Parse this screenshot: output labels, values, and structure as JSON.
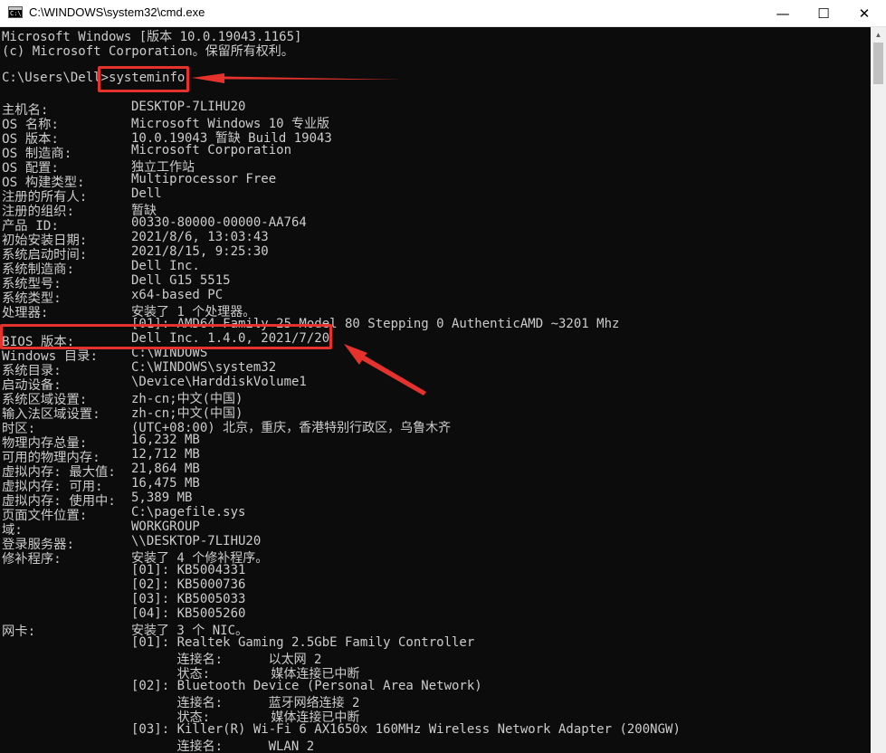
{
  "window": {
    "title": "C:\\WINDOWS\\system32\\cmd.exe",
    "minimize_glyph": "—",
    "maximize_glyph": "☐",
    "close_glyph": "✕"
  },
  "console": {
    "header_lines": [
      "Microsoft Windows [版本 10.0.19043.1165]",
      "(c) Microsoft Corporation。保留所有权利。"
    ],
    "prompt": "C:\\Users\\Dell>",
    "command": "systeminfo",
    "rows": [
      {
        "key": "主机名:",
        "value": "DESKTOP-7LIHU20"
      },
      {
        "key": "OS 名称:",
        "value": "Microsoft Windows 10 专业版"
      },
      {
        "key": "OS 版本:",
        "value": "10.0.19043 暂缺 Build 19043"
      },
      {
        "key": "OS 制造商:",
        "value": "Microsoft Corporation"
      },
      {
        "key": "OS 配置:",
        "value": "独立工作站"
      },
      {
        "key": "OS 构建类型:",
        "value": "Multiprocessor Free"
      },
      {
        "key": "注册的所有人:",
        "value": "Dell"
      },
      {
        "key": "注册的组织:",
        "value": "暂缺"
      },
      {
        "key": "产品 ID:",
        "value": "00330-80000-00000-AA764"
      },
      {
        "key": "初始安装日期:",
        "value": "2021/8/6, 13:03:43"
      },
      {
        "key": "系统启动时间:",
        "value": "2021/8/15, 9:25:30"
      },
      {
        "key": "系统制造商:",
        "value": "Dell Inc."
      },
      {
        "key": "系统型号:",
        "value": "Dell G15 5515"
      },
      {
        "key": "系统类型:",
        "value": "x64-based PC"
      },
      {
        "key": "处理器:",
        "value": "安装了 1 个处理器。"
      },
      {
        "key": "",
        "value": "[01]: AMD64 Family 25 Model 80 Stepping 0 AuthenticAMD ~3201 Mhz"
      },
      {
        "key": "BIOS 版本:",
        "value": "Dell Inc. 1.4.0, 2021/7/20"
      },
      {
        "key": "Windows 目录:",
        "value": "C:\\WINDOWS"
      },
      {
        "key": "系统目录:",
        "value": "C:\\WINDOWS\\system32"
      },
      {
        "key": "启动设备:",
        "value": "\\Device\\HarddiskVolume1"
      },
      {
        "key": "系统区域设置:",
        "value": "zh-cn;中文(中国)"
      },
      {
        "key": "输入法区域设置:",
        "value": "zh-cn;中文(中国)"
      },
      {
        "key": "时区:",
        "value": "(UTC+08:00) 北京，重庆，香港特别行政区，乌鲁木齐"
      },
      {
        "key": "物理内存总量:",
        "value": "16,232 MB"
      },
      {
        "key": "可用的物理内存:",
        "value": "12,712 MB"
      },
      {
        "key": "虚拟内存: 最大值:",
        "value": "21,864 MB"
      },
      {
        "key": "虚拟内存: 可用:",
        "value": "16,475 MB"
      },
      {
        "key": "虚拟内存: 使用中:",
        "value": "5,389 MB"
      },
      {
        "key": "页面文件位置:",
        "value": "C:\\pagefile.sys"
      },
      {
        "key": "域:",
        "value": "WORKGROUP"
      },
      {
        "key": "登录服务器:",
        "value": "\\\\DESKTOP-7LIHU20"
      },
      {
        "key": "修补程序:",
        "value": "安装了 4 个修补程序。"
      },
      {
        "key": "",
        "value": "[01]: KB5004331"
      },
      {
        "key": "",
        "value": "[02]: KB5000736"
      },
      {
        "key": "",
        "value": "[03]: KB5005033"
      },
      {
        "key": "",
        "value": "[04]: KB5005260"
      },
      {
        "key": "网卡:",
        "value": "安装了 3 个 NIC。"
      },
      {
        "key": "",
        "value": "[01]: Realtek Gaming 2.5GbE Family Controller"
      },
      {
        "key": "",
        "value": "      连接名:      以太网 2"
      },
      {
        "key": "",
        "value": "      状态:        媒体连接已中断"
      },
      {
        "key": "",
        "value": "[02]: Bluetooth Device (Personal Area Network)"
      },
      {
        "key": "",
        "value": "      连接名:      蓝牙网络连接 2"
      },
      {
        "key": "",
        "value": "      状态:        媒体连接已中断"
      },
      {
        "key": "",
        "value": "[03]: Killer(R) Wi-Fi 6 AX1650x 160MHz Wireless Network Adapter (200NGW)"
      },
      {
        "key": "",
        "value": "      连接名:      WLAN 2"
      }
    ]
  },
  "colors": {
    "console_bg": "#0c0c0c",
    "console_text": "#cccccc",
    "annotation": "#e5322d"
  }
}
